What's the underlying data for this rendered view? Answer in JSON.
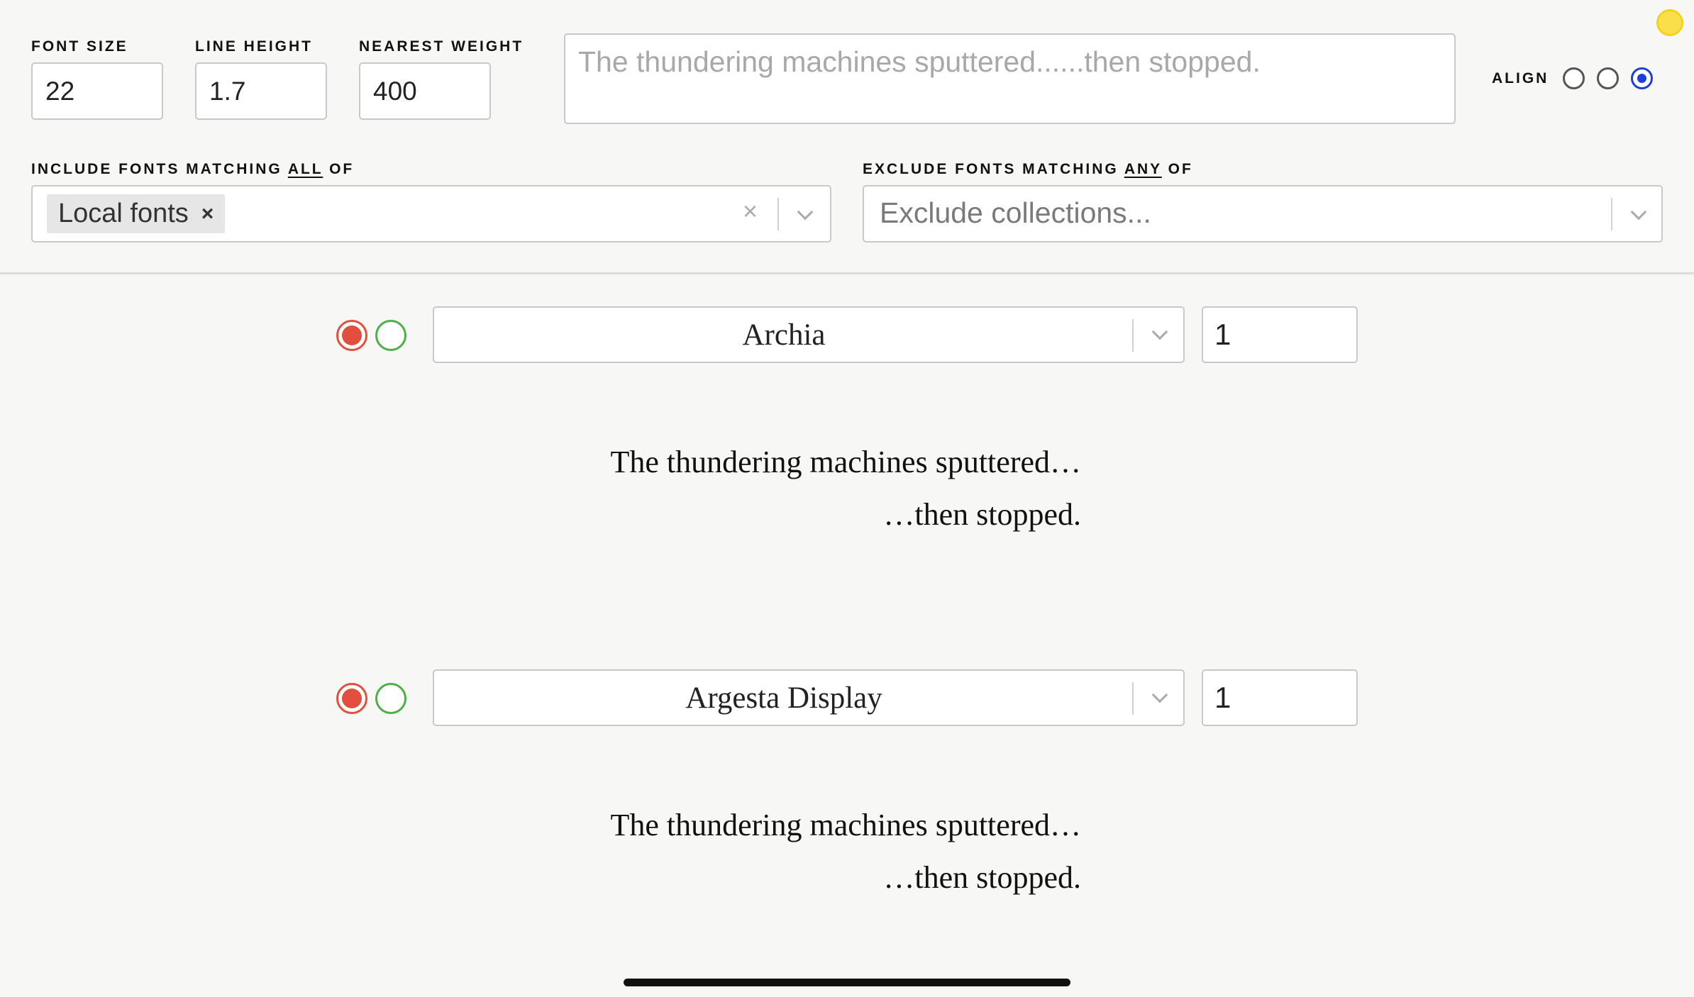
{
  "controls": {
    "font_size": {
      "label": "Font size",
      "value": "22"
    },
    "line_height": {
      "label": "Line height",
      "value": "1.7"
    },
    "nearest_weight": {
      "label": "Nearest weight",
      "value": "400"
    },
    "sample_text_placeholder": "The thundering machines sputtered......then stopped.",
    "align": {
      "label": "Align",
      "options": [
        "left",
        "center",
        "right"
      ],
      "selected": "right"
    }
  },
  "include_filter": {
    "label_prefix": "Include fonts matching ",
    "label_emph": "all",
    "label_suffix": " of",
    "chips": [
      "Local fonts"
    ],
    "chip_remove": "×",
    "clear": "×"
  },
  "exclude_filter": {
    "label_prefix": "Exclude fonts matching ",
    "label_emph": "any",
    "label_suffix": " of",
    "placeholder": "Exclude collections..."
  },
  "specimens": [
    {
      "font": "Archia",
      "weight_index": "1",
      "lines": [
        "The thundering machines sputtered…",
        "…then stopped."
      ]
    },
    {
      "font": "Argesta Display",
      "weight_index": "1",
      "lines": [
        "The thundering machines sputtered…",
        "…then stopped."
      ]
    }
  ],
  "colors": {
    "accent": "#1d3fd8",
    "reject": "#e34f3f",
    "accept": "#4caf48",
    "theme_toggle": "#f9e04a"
  },
  "icons": [
    "sun-icon",
    "chevron-down-icon",
    "close-icon"
  ]
}
